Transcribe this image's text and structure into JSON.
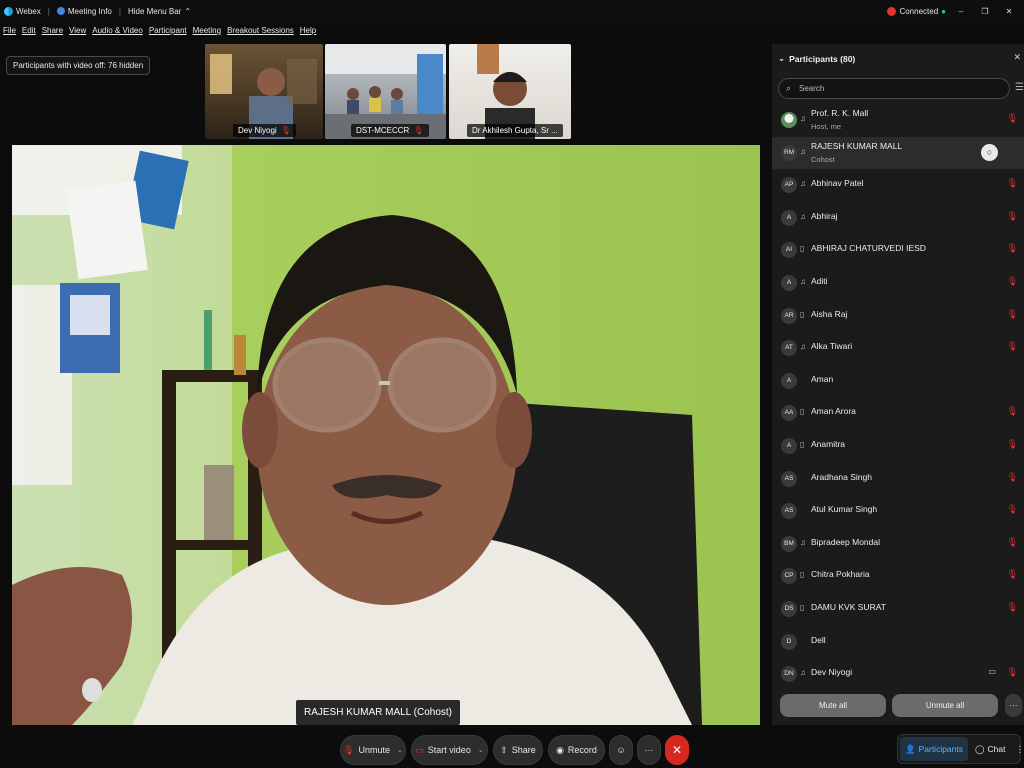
{
  "titlebar": {
    "app": "Webex",
    "meeting_info": "Meeting Info",
    "hide_menu": "Hide Menu Bar",
    "status": "Connected"
  },
  "menu": [
    "File",
    "Edit",
    "Share",
    "View",
    "Audio & Video",
    "Participant",
    "Meeting",
    "Breakout Sessions",
    "Help"
  ],
  "hidden_notice": "Participants with video off: 76 hidden",
  "thumbnails": [
    {
      "name": "Dev Niyogi",
      "mic": "muted"
    },
    {
      "name": "DST-MCECCR",
      "mic": "muted"
    },
    {
      "name": "Dr Akhilesh Gupta, Sr ...",
      "mic": ""
    }
  ],
  "active_speaker": "RAJESH KUMAR MALL (Cohost)",
  "controls": {
    "unmute": "Unmute",
    "start_video": "Start video",
    "share": "Share",
    "record": "Record",
    "more": "···",
    "end": "✕"
  },
  "panel": {
    "title": "Participants (80)",
    "search_placeholder": "Search",
    "mute_all": "Mute all",
    "unmute_all": "Unmute all",
    "more": "···"
  },
  "participants": [
    {
      "initials": "",
      "name": "Prof. R. K. Mall",
      "role": "Host, me",
      "device": "headset",
      "muted": true,
      "camera": false,
      "selected": false
    },
    {
      "initials": "RM",
      "name": "RAJESH KUMAR MALL",
      "role": "Cohost",
      "device": "headset",
      "muted": false,
      "camera": false,
      "selected": true
    },
    {
      "initials": "AP",
      "name": "Abhinav Patel",
      "role": "",
      "device": "headset",
      "muted": true,
      "camera": false,
      "selected": false
    },
    {
      "initials": "A",
      "name": "Abhiraj",
      "role": "",
      "device": "headset",
      "muted": true,
      "camera": false,
      "selected": false
    },
    {
      "initials": "AI",
      "name": "ABHIRAJ CHATURVEDI IESD",
      "role": "",
      "device": "phone",
      "muted": true,
      "camera": false,
      "selected": false
    },
    {
      "initials": "A",
      "name": "Aditi",
      "role": "",
      "device": "headset",
      "muted": true,
      "camera": false,
      "selected": false
    },
    {
      "initials": "AR",
      "name": "Aisha Raj",
      "role": "",
      "device": "phone",
      "muted": true,
      "camera": false,
      "selected": false
    },
    {
      "initials": "AT",
      "name": "Alka Tiwari",
      "role": "",
      "device": "headset",
      "muted": true,
      "camera": false,
      "selected": false
    },
    {
      "initials": "A",
      "name": "Aman",
      "role": "",
      "device": "",
      "muted": false,
      "camera": false,
      "selected": false
    },
    {
      "initials": "AA",
      "name": "Aman Arora",
      "role": "",
      "device": "phone",
      "muted": true,
      "camera": false,
      "selected": false
    },
    {
      "initials": "A",
      "name": "Anamitra",
      "role": "",
      "device": "phone",
      "muted": true,
      "camera": false,
      "selected": false
    },
    {
      "initials": "AS",
      "name": "Aradhana Singh",
      "role": "",
      "device": "",
      "muted": true,
      "camera": false,
      "selected": false
    },
    {
      "initials": "AS",
      "name": "Atul Kumar Singh",
      "role": "",
      "device": "",
      "muted": true,
      "camera": false,
      "selected": false
    },
    {
      "initials": "BM",
      "name": "Bipradeep Mondal",
      "role": "",
      "device": "headset",
      "muted": true,
      "camera": false,
      "selected": false
    },
    {
      "initials": "CP",
      "name": "Chitra Pokharia",
      "role": "",
      "device": "phone",
      "muted": true,
      "camera": false,
      "selected": false
    },
    {
      "initials": "DS",
      "name": "DAMU KVK SURAT",
      "role": "",
      "device": "phone",
      "muted": true,
      "camera": false,
      "selected": false
    },
    {
      "initials": "D",
      "name": "Dell",
      "role": "",
      "device": "",
      "muted": false,
      "camera": false,
      "selected": false
    },
    {
      "initials": "DN",
      "name": "Dev Niyogi",
      "role": "",
      "device": "headset",
      "muted": true,
      "camera": true,
      "selected": false
    }
  ],
  "tabs": {
    "participants": "Participants",
    "chat": "Chat",
    "more": "⋮"
  },
  "colors": {
    "muted_red": "#e0342f",
    "active_tab": "#5ab4ff",
    "end_button": "#d7281f",
    "wall_green": "#9fc75a"
  },
  "icons": {
    "headset": "headset-icon",
    "phone": "phone-icon",
    "mic_muted": "mic-muted-icon",
    "camera": "camera-icon"
  }
}
